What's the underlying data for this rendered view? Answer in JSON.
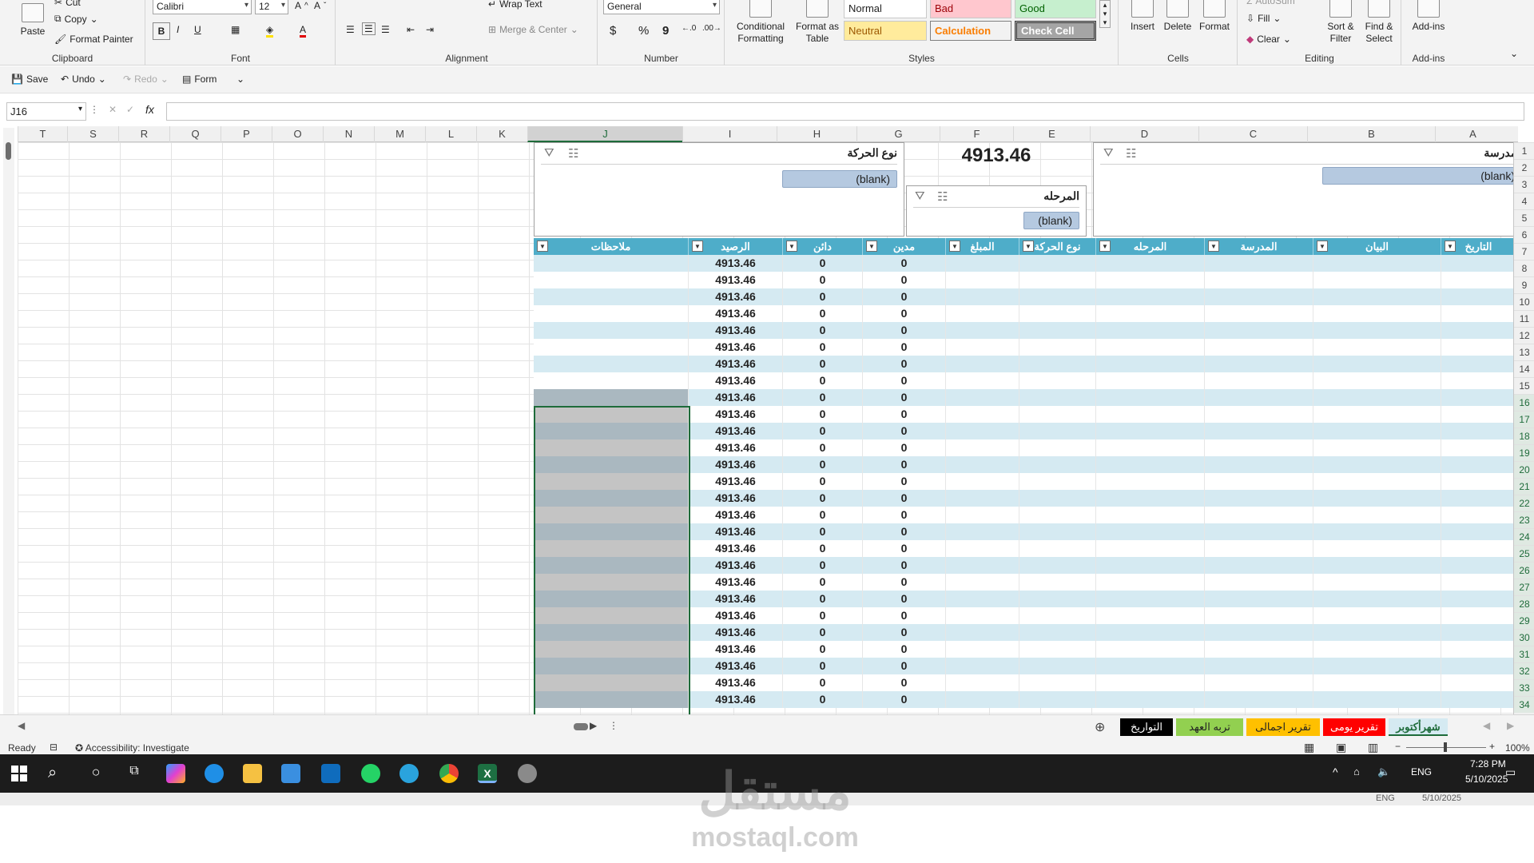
{
  "ribbon": {
    "clipboard": {
      "paste": "Paste",
      "cut": "Cut",
      "copy": "Copy",
      "format_painter": "Format Painter",
      "label": "Clipboard"
    },
    "font": {
      "family": "Calibri",
      "size": "12",
      "label": "Font",
      "bold": "B",
      "italic": "I",
      "underline": "U"
    },
    "alignment": {
      "wrap_text": "Wrap Text",
      "merge_center": "Merge & Center",
      "label": "Alignment"
    },
    "number": {
      "format": "General",
      "currency": "$",
      "percent": "%",
      "comma": "9",
      "label": "Number"
    },
    "styles": {
      "conditional": "Conditional Formatting",
      "format_table": "Format as Table",
      "normal": "Normal",
      "bad": "Bad",
      "good": "Good",
      "neutral": "Neutral",
      "calculation": "Calculation",
      "check_cell": "Check Cell",
      "label": "Styles"
    },
    "cells": {
      "insert": "Insert",
      "delete": "Delete",
      "format": "Format",
      "label": "Cells"
    },
    "editing": {
      "autosum": "AutoSum",
      "fill": "Fill",
      "clear": "Clear",
      "sort_filter": "Sort & Filter",
      "find_select": "Find & Select",
      "label": "Editing"
    },
    "addins": {
      "addins": "Add-ins",
      "label": "Add-ins"
    }
  },
  "qat": {
    "save": "Save",
    "undo": "Undo",
    "redo": "Redo",
    "form": "Form"
  },
  "formula_bar": {
    "name_box": "J16",
    "fx": "fx",
    "value": ""
  },
  "columns": [
    "T",
    "S",
    "R",
    "Q",
    "P",
    "O",
    "N",
    "M",
    "L",
    "K",
    "J",
    "I",
    "H",
    "G",
    "F",
    "E",
    "D",
    "C",
    "B",
    "A"
  ],
  "rows": [
    "1",
    "2",
    "3",
    "4",
    "5",
    "6",
    "7",
    "8",
    "9",
    "10",
    "11",
    "12",
    "13",
    "14",
    "15",
    "16",
    "17",
    "18",
    "19",
    "20",
    "21",
    "22",
    "23",
    "24",
    "25",
    "26",
    "27",
    "28",
    "29",
    "30",
    "31",
    "32",
    "33",
    "34"
  ],
  "headline_value": "4913.46",
  "slicers": {
    "school": {
      "title": "المدرسة",
      "item": "(blank)"
    },
    "movement": {
      "title": "نوع الحركة",
      "item": "(blank)"
    },
    "stage": {
      "title": "المرحله",
      "item": "(blank)"
    }
  },
  "table": {
    "headers": [
      "ملاحظات",
      "الرصيد",
      "دائن",
      "مدين",
      "المبلغ",
      "نوع الحركة",
      "المرحله",
      "المدرسة",
      "البيان",
      "التاريخ"
    ],
    "balance": "4913.46",
    "credit": "0",
    "debit": "0"
  },
  "sheet_tabs": [
    {
      "label": "شهرأكتوبر",
      "color": "#d5eaf2"
    },
    {
      "label": "تقرير يومى",
      "color": "#ff0000"
    },
    {
      "label": "تقرير اجمالى",
      "color": "#ffc000"
    },
    {
      "label": "تربه العهد",
      "color": "#92d050"
    },
    {
      "label": "التواريخ",
      "color": "#000000"
    }
  ],
  "status": {
    "ready": "Ready",
    "accessibility": "Accessibility: Investigate",
    "zoom": "100%"
  },
  "taskbar": {
    "lang": "ENG",
    "time": "7:28 PM",
    "date": "5/10/2025",
    "lang2": "ENG",
    "date2": "5/10/2025"
  },
  "watermark": {
    "brand": "مستقل",
    "site": "mostaql.com"
  }
}
